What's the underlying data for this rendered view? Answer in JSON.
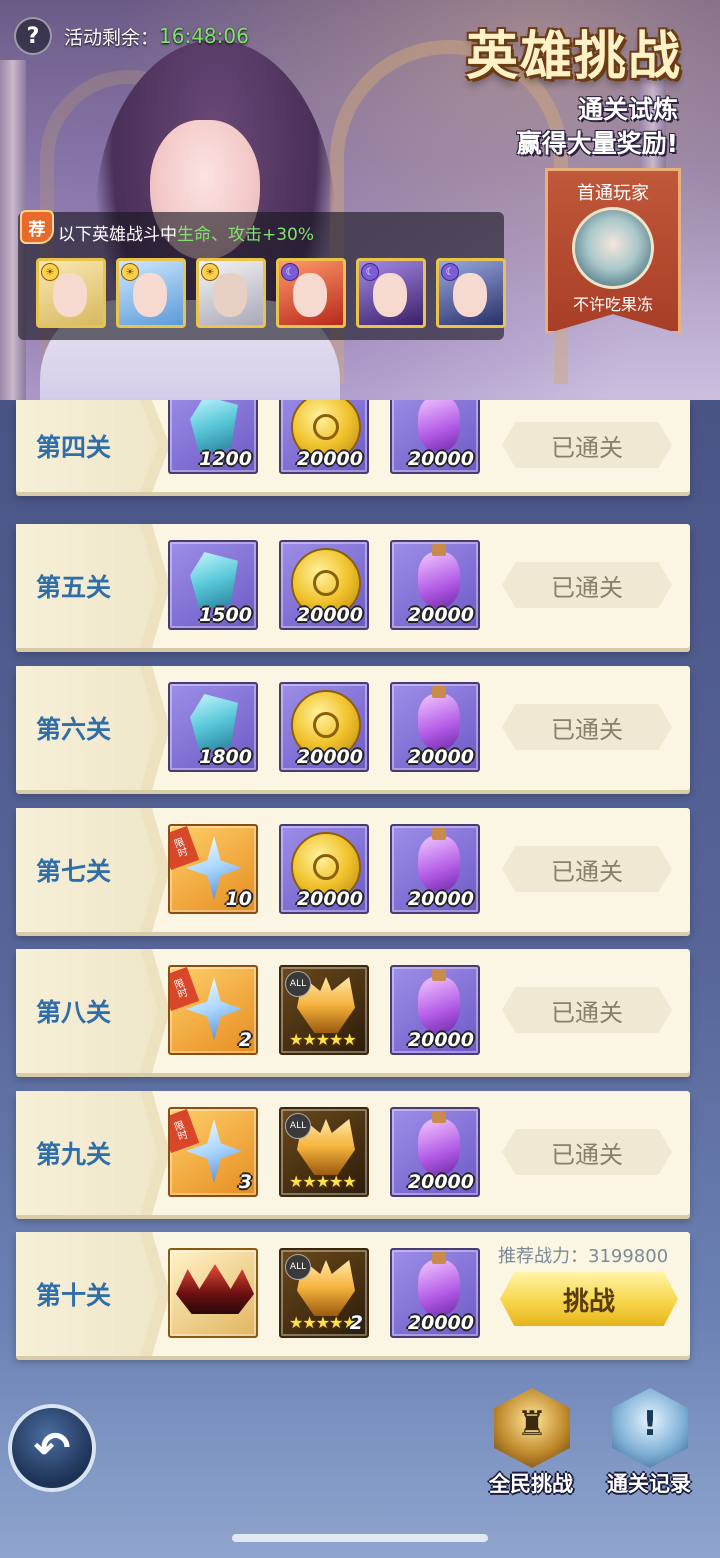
{
  "header": {
    "timer_label": "活动剩余：",
    "timer_value": "16:48:06",
    "title": "英雄挑战",
    "subtitle_1": "通关试炼",
    "subtitle_2": "赢得大量奖励!"
  },
  "first_clear": {
    "label": "首通玩家",
    "player": "不许吃果冻"
  },
  "buff": {
    "tag": "荐",
    "text_prefix": "以下英雄战斗中",
    "text_highlight": "生命、攻击+30%",
    "heroes": [
      {
        "name": "hero-1",
        "color": "#f2d68a"
      },
      {
        "name": "hero-2",
        "color": "#7fb6e8"
      },
      {
        "name": "hero-3",
        "color": "#d8d8d8"
      },
      {
        "name": "hero-4",
        "color": "#e0503a"
      },
      {
        "name": "hero-5",
        "color": "#6a4ab8"
      },
      {
        "name": "hero-6",
        "color": "#5a6aa8"
      }
    ]
  },
  "stages": [
    {
      "name": "第四关",
      "rewards": [
        "1200",
        "20000",
        "20000"
      ],
      "status": "已通关"
    },
    {
      "name": "第五关",
      "rewards": [
        "1500",
        "20000",
        "20000"
      ],
      "status": "已通关"
    },
    {
      "name": "第六关",
      "rewards": [
        "1800",
        "20000",
        "20000"
      ],
      "status": "已通关"
    },
    {
      "name": "第七关",
      "rewards": [
        "10",
        "20000",
        "20000"
      ],
      "status": "已通关"
    },
    {
      "name": "第八关",
      "rewards": [
        "2",
        "",
        "20000"
      ],
      "status": "已通关"
    },
    {
      "name": "第九关",
      "rewards": [
        "3",
        "",
        "20000"
      ],
      "status": "已通关"
    },
    {
      "name": "第十关",
      "rewards": [
        "",
        "2",
        "20000"
      ],
      "power_label": "推荐战力：3199800",
      "button": "挑战"
    }
  ],
  "limited_tag": "限时",
  "all_tag": "ALL",
  "stars": "★★★★★",
  "bottom": {
    "back_icon": "↶",
    "global_challenge": "全民挑战",
    "clear_record": "通关记录"
  }
}
